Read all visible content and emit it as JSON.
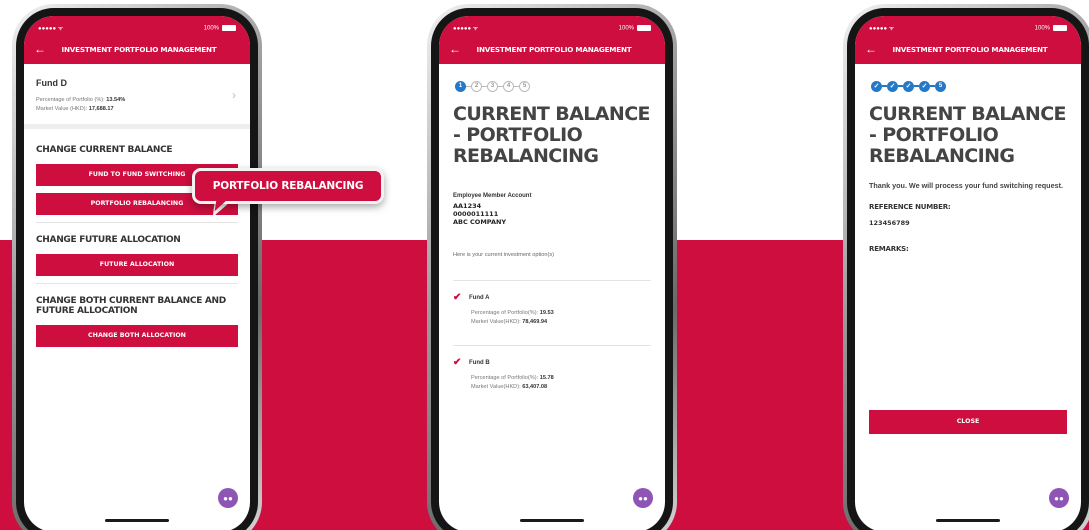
{
  "colors": {
    "brand_red": "#cd0e3f",
    "step_blue": "#2478c8",
    "chat_purple": "#8e55b5"
  },
  "callout": {
    "label": "PORTFOLIO REBALANCING"
  },
  "phone1": {
    "status": {
      "signal": "●●●●● ᯤ",
      "battery": "100%"
    },
    "header": {
      "title": "INVESTMENT PORTFOLIO MANAGEMENT",
      "back_icon": "arrow-left-icon"
    },
    "fund": {
      "name": "Fund D",
      "pct_label": "Percentage of Portfolio (%):",
      "pct_value": "13.54%",
      "mv_label": "Market Value (HKD):",
      "mv_value": "17,688.17"
    },
    "section_current": "CHANGE CURRENT BALANCE",
    "btn_switching": "FUND TO FUND SWITCHING",
    "btn_rebalancing": "PORTFOLIO REBALANCING",
    "section_future": "CHANGE FUTURE ALLOCATION",
    "btn_future": "FUTURE ALLOCATION",
    "section_both": "CHANGE BOTH CURRENT BALANCE AND FUTURE ALLOCATION",
    "btn_both": "CHANGE BOTH ALLOCATION"
  },
  "phone2": {
    "status": {
      "signal": "●●●●● ᯤ",
      "battery": "100%"
    },
    "header": {
      "title": "INVESTMENT PORTFOLIO MANAGEMENT"
    },
    "steps": [
      "1",
      "2",
      "3",
      "4",
      "5"
    ],
    "current_step": 1,
    "title": "CURRENT BALANCE - PORTFOLIO REBALANCING",
    "account_label": "Employee Member Account",
    "account_id": "AA1234",
    "account_no": "0000011111",
    "company": "ABC COMPANY",
    "intro": "Here is your current investment option(s)",
    "funds": [
      {
        "name": "Fund A",
        "pct_label": "Percentage of Portfolio(%):",
        "pct": "19.53",
        "mv_label": "Market Value(HKD):",
        "mv": "78,469.94"
      },
      {
        "name": "Fund B",
        "pct_label": "Percentage of Portfolio(%):",
        "pct": "15.78",
        "mv_label": "Market Value(HKD):",
        "mv": "63,407.08"
      }
    ]
  },
  "phone3": {
    "status": {
      "signal": "●●●●● ᯤ",
      "battery": "100%"
    },
    "header": {
      "title": "INVESTMENT PORTFOLIO MANAGEMENT"
    },
    "last_step": "5",
    "title": "CURRENT BALANCE - PORTFOLIO REBALANCING",
    "message": "Thank you. We will process your fund switching request.",
    "ref_label": "REFERENCE NUMBER:",
    "ref_value": "123456789",
    "remarks_label": "REMARKS:",
    "close_button": "CLOSE"
  }
}
